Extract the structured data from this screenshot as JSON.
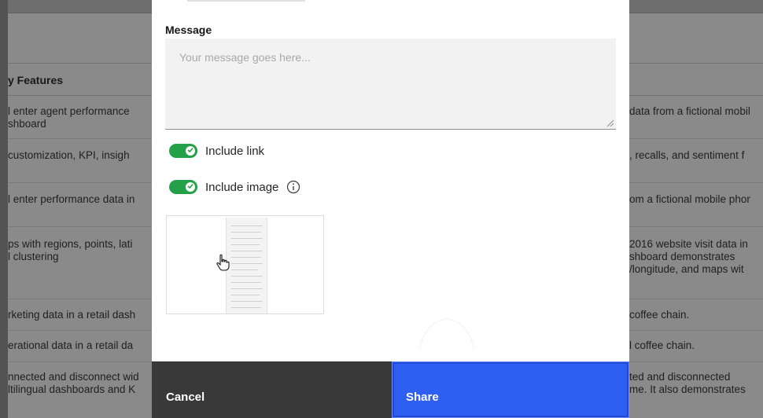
{
  "background": {
    "column_title": "y Features",
    "left_rows": [
      [
        "l enter agent performance",
        "shboard"
      ],
      [
        "customization, KPI, insigh"
      ],
      [
        "l enter performance data in"
      ],
      [
        "ps with regions, points, lati",
        "l clustering"
      ],
      [
        "rketing data in a retail dash"
      ],
      [
        "erational data in a retail da"
      ],
      [
        "nnected and disconnect wid",
        "ltilingual dashboards and K"
      ]
    ],
    "right_rows": [
      [
        "data from a fictional mobil"
      ],
      [
        ", recalls, and sentiment f"
      ],
      [
        "om a fictional mobile phor"
      ],
      [
        "2016 website visit data in",
        "shboard demonstrates",
        "/longitude, and maps wit"
      ],
      [
        "coffee chain."
      ],
      [
        "l coffee chain."
      ],
      [
        "ted and disconnected",
        "me. It also demonstrates"
      ]
    ]
  },
  "modal": {
    "message_label": "Message",
    "message_placeholder": "Your message goes here...",
    "message_value": "",
    "include_link_label": "Include link",
    "include_link_on": true,
    "include_image_label": "Include image",
    "include_image_on": true,
    "cancel_label": "Cancel",
    "share_label": "Share",
    "icons": {
      "toggle_check": "checkmark-icon",
      "info": "info-icon",
      "cursor": "hand-pointer-cursor-icon"
    },
    "colors": {
      "toggle_on": "#24a148",
      "primary": "#2f5ff2",
      "secondary": "#393939"
    }
  }
}
